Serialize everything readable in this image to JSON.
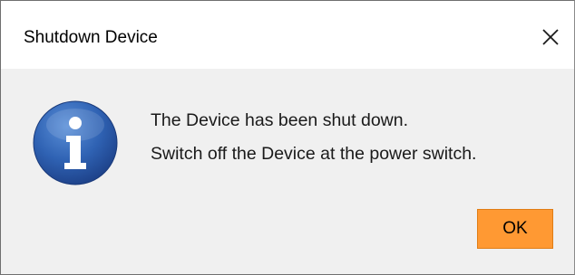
{
  "window": {
    "title": "Shutdown Device",
    "close_icon": "close-icon"
  },
  "message": {
    "icon": "info-icon",
    "line1": "The Device has been shut down.",
    "line2": "Switch off the Device at the power switch."
  },
  "buttons": {
    "ok_label": "OK"
  },
  "colors": {
    "ok_button": "#ff9933",
    "info_icon": "#2a5da8",
    "dialog_body": "#f0f0f0",
    "titlebar": "#ffffff"
  }
}
